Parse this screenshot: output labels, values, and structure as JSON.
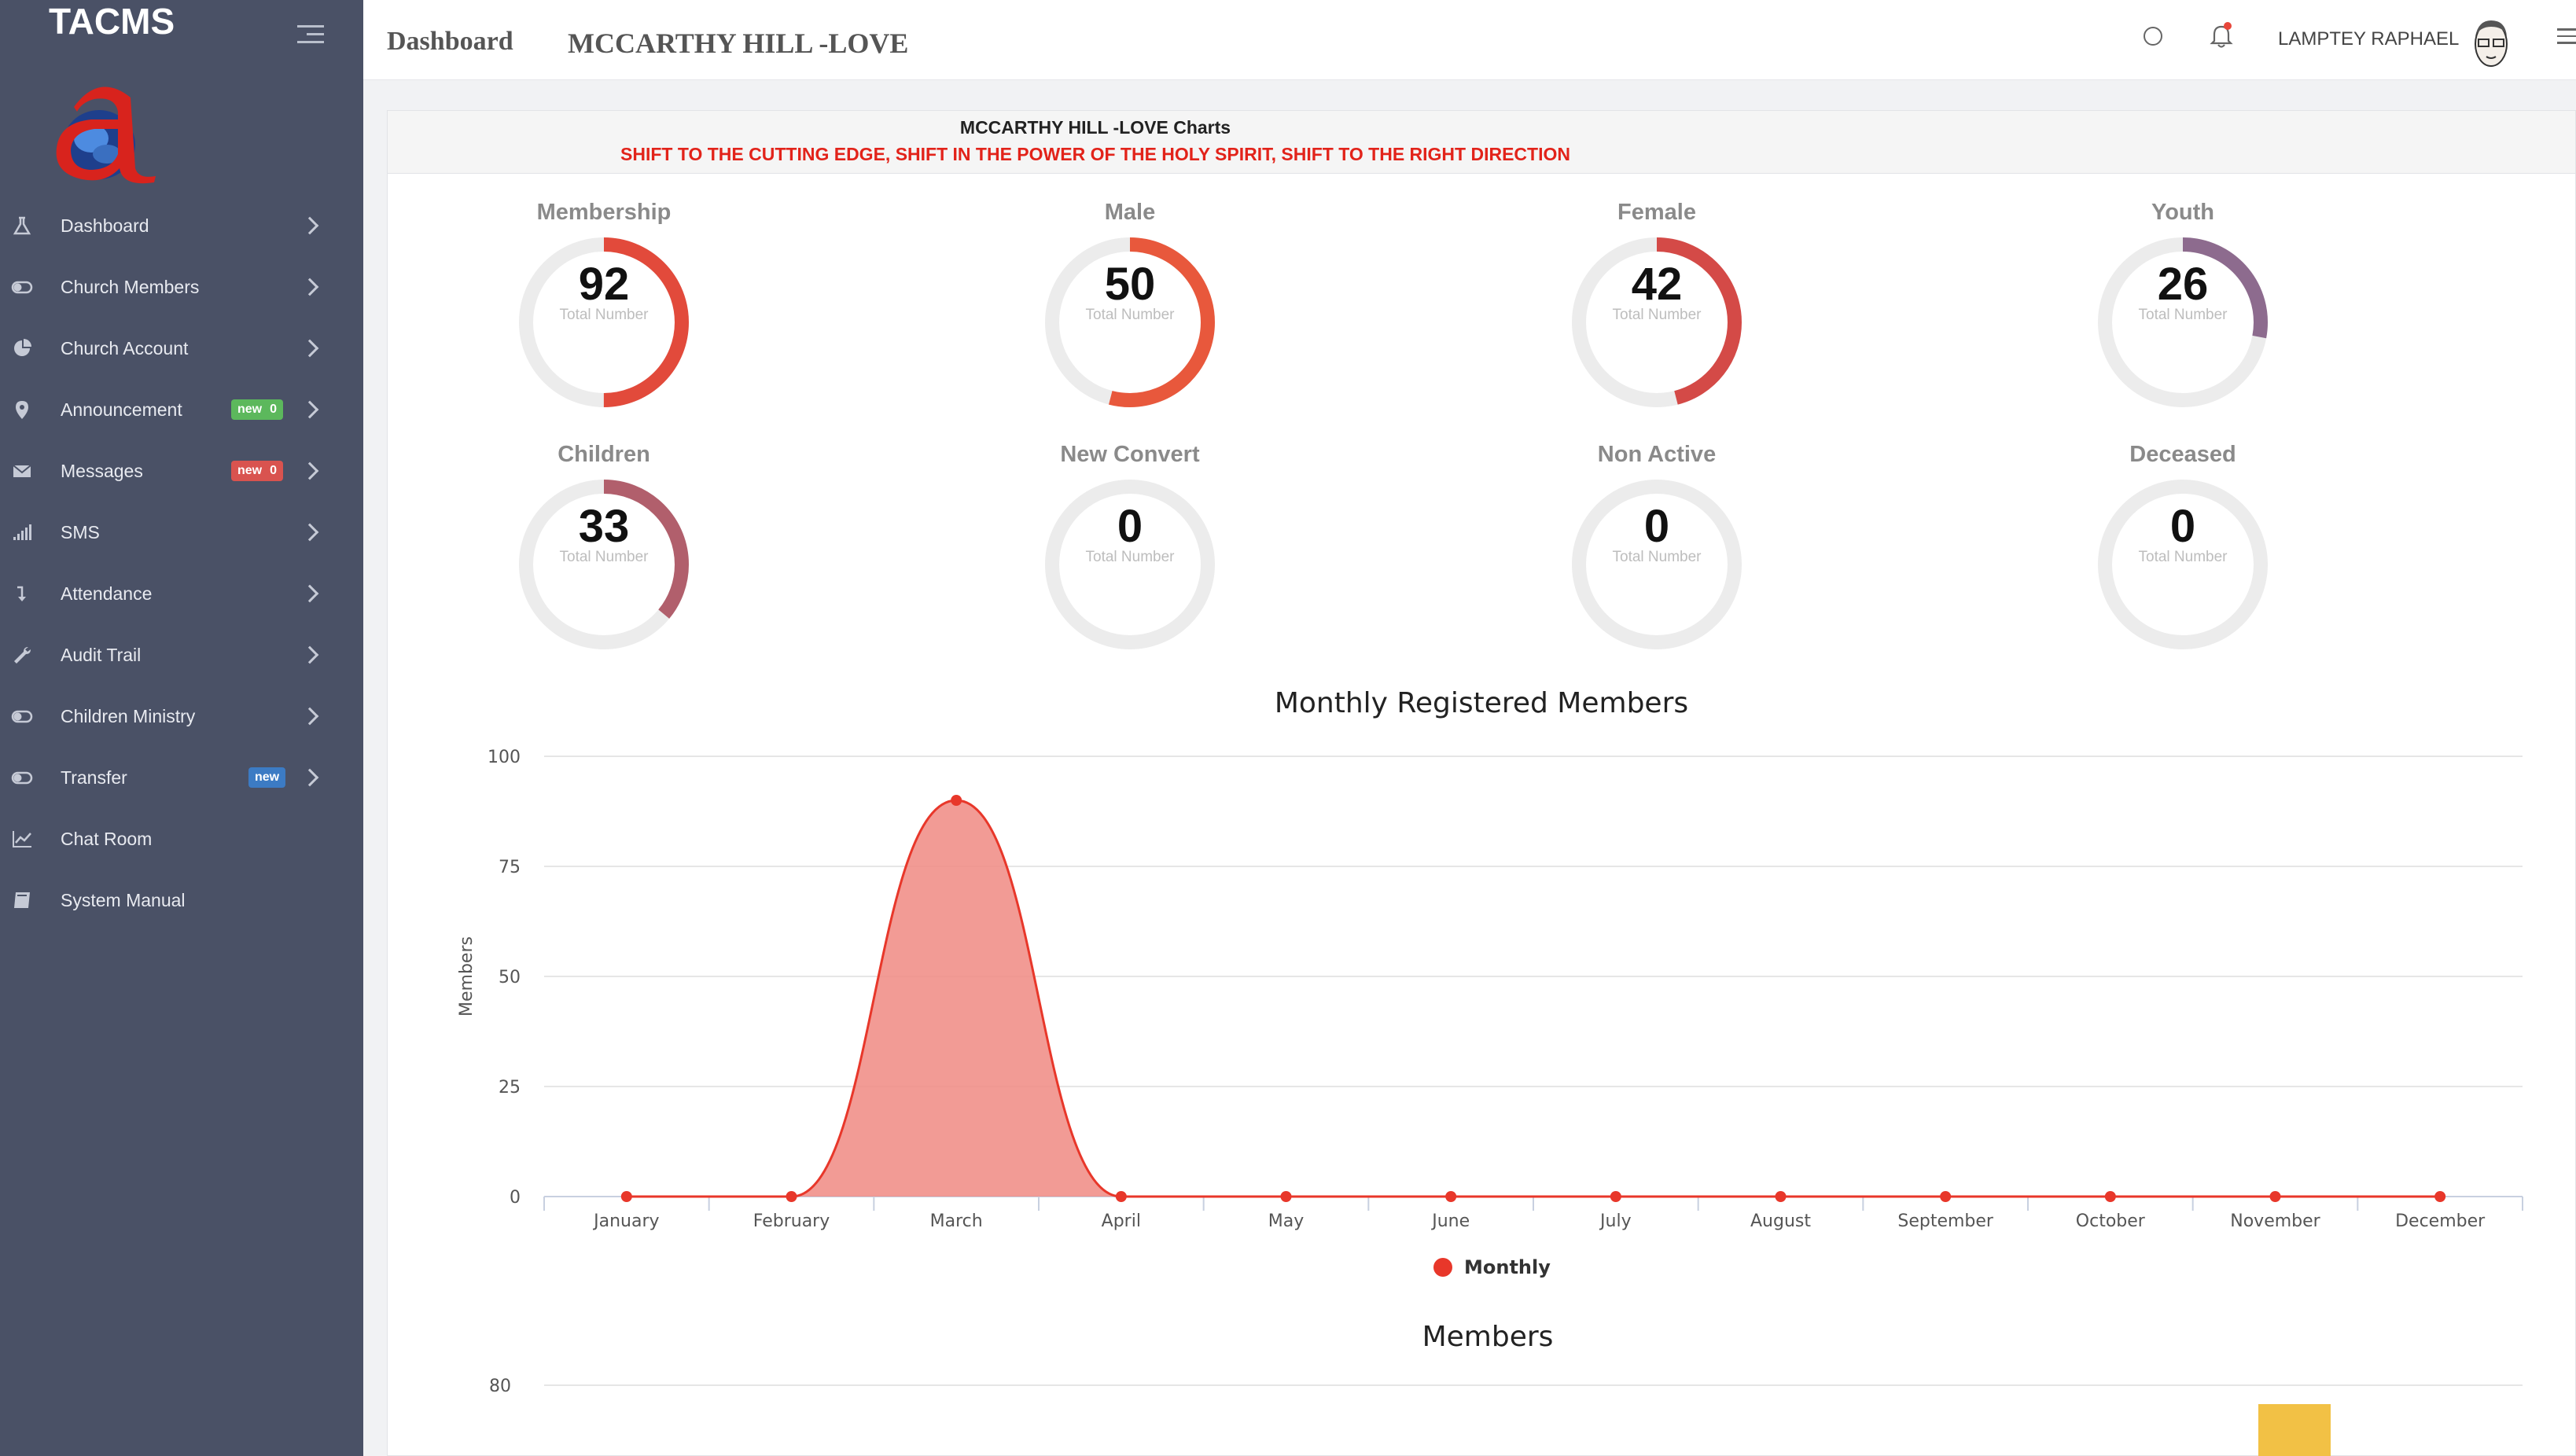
{
  "sidebar": {
    "brand": "TACMS",
    "items": [
      {
        "label": "Dashboard",
        "icon": "flask-icon",
        "name": "sidebar-item-dashboard",
        "chevron": true
      },
      {
        "label": "Church Members",
        "icon": "toggle-icon",
        "name": "sidebar-item-church-members",
        "chevron": true
      },
      {
        "label": "Church Account",
        "icon": "pie-chart-icon",
        "name": "sidebar-item-church-account",
        "chevron": true
      },
      {
        "label": "Announcement",
        "icon": "map-pin-icon",
        "name": "sidebar-item-announcement",
        "chevron": true,
        "badge": {
          "text": "new",
          "count": "0",
          "color": "#5cb85c"
        }
      },
      {
        "label": "Messages",
        "icon": "envelope-icon",
        "name": "sidebar-item-messages",
        "chevron": true,
        "badge": {
          "text": "new",
          "count": "0",
          "color": "#d9534f"
        }
      },
      {
        "label": "SMS",
        "icon": "signal-icon",
        "name": "sidebar-item-sms",
        "chevron": true
      },
      {
        "label": "Attendance",
        "icon": "level-down-icon",
        "name": "sidebar-item-attendance",
        "chevron": true
      },
      {
        "label": "Audit Trail",
        "icon": "wrench-icon",
        "name": "sidebar-item-audit-trail",
        "chevron": true
      },
      {
        "label": "Children Ministry",
        "icon": "toggle-icon",
        "name": "sidebar-item-children-ministry",
        "chevron": true
      },
      {
        "label": "Transfer",
        "icon": "toggle-icon",
        "name": "sidebar-item-transfer",
        "chevron": true,
        "badge": {
          "text": "new",
          "count": "",
          "color": "#3c7bc4"
        }
      },
      {
        "label": "Chat Room",
        "icon": "line-chart-icon",
        "name": "sidebar-item-chat-room",
        "chevron": false
      },
      {
        "label": "System Manual",
        "icon": "book-icon",
        "name": "sidebar-item-system-manual",
        "chevron": false
      }
    ]
  },
  "topbar": {
    "dashboard_label": "Dashboard",
    "church_name": "MCCARTHY HILL -LOVE",
    "user_name": "LAMPTEY RAPHAEL"
  },
  "card": {
    "title": "MCCARTHY HILL -LOVE Charts",
    "motto": "SHIFT TO THE CUTTING EDGE, SHIFT IN THE POWER OF THE HOLY SPIRIT, SHIFT TO THE RIGHT DIRECTION"
  },
  "stats": [
    {
      "title": "Membership",
      "value": "92",
      "sub": "Total Number",
      "fraction": 0.5,
      "color": "#e24a3b"
    },
    {
      "title": "Male",
      "value": "50",
      "sub": "Total Number",
      "fraction": 0.54,
      "color": "#e8583c"
    },
    {
      "title": "Female",
      "value": "42",
      "sub": "Total Number",
      "fraction": 0.46,
      "color": "#d44a47"
    },
    {
      "title": "Youth",
      "value": "26",
      "sub": "Total Number",
      "fraction": 0.28,
      "color": "#8d6b8e"
    },
    {
      "title": "Children",
      "value": "33",
      "sub": "Total Number",
      "fraction": 0.36,
      "color": "#b15f6c"
    },
    {
      "title": "New Convert",
      "value": "0",
      "sub": "Total Number",
      "fraction": 0,
      "color": "#e24a3b"
    },
    {
      "title": "Non Active",
      "value": "0",
      "sub": "Total Number",
      "fraction": 0,
      "color": "#e24a3b"
    },
    {
      "title": "Deceased",
      "value": "0",
      "sub": "Total Number",
      "fraction": 0,
      "color": "#e24a3b"
    }
  ],
  "chart_data": [
    {
      "type": "area",
      "title": "Monthly Registered Members",
      "xlabel": "",
      "ylabel": "Members",
      "ylim": [
        0,
        100
      ],
      "yticks": [
        0,
        25,
        50,
        75,
        100
      ],
      "categories": [
        "January",
        "February",
        "March",
        "April",
        "May",
        "June",
        "July",
        "August",
        "September",
        "October",
        "November",
        "December"
      ],
      "series": [
        {
          "name": "Monthly",
          "values": [
            0,
            0,
            90,
            0,
            0,
            0,
            0,
            0,
            0,
            0,
            0,
            0
          ],
          "color": "#e8372a"
        }
      ],
      "legend": "bottom-center",
      "grid": true
    },
    {
      "type": "bar",
      "title": "Members",
      "yticks_visible": [
        80
      ],
      "bar_color": "#f2c145"
    }
  ]
}
